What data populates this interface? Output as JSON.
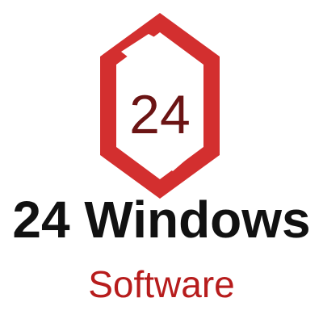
{
  "logo": {
    "monogram": "24",
    "title": "24 Windows",
    "subtitle": "Software",
    "colors": {
      "frame": "#d32f2f",
      "monogram": "#6b1414",
      "title": "#111111",
      "subtitle": "#b71c1c"
    }
  }
}
